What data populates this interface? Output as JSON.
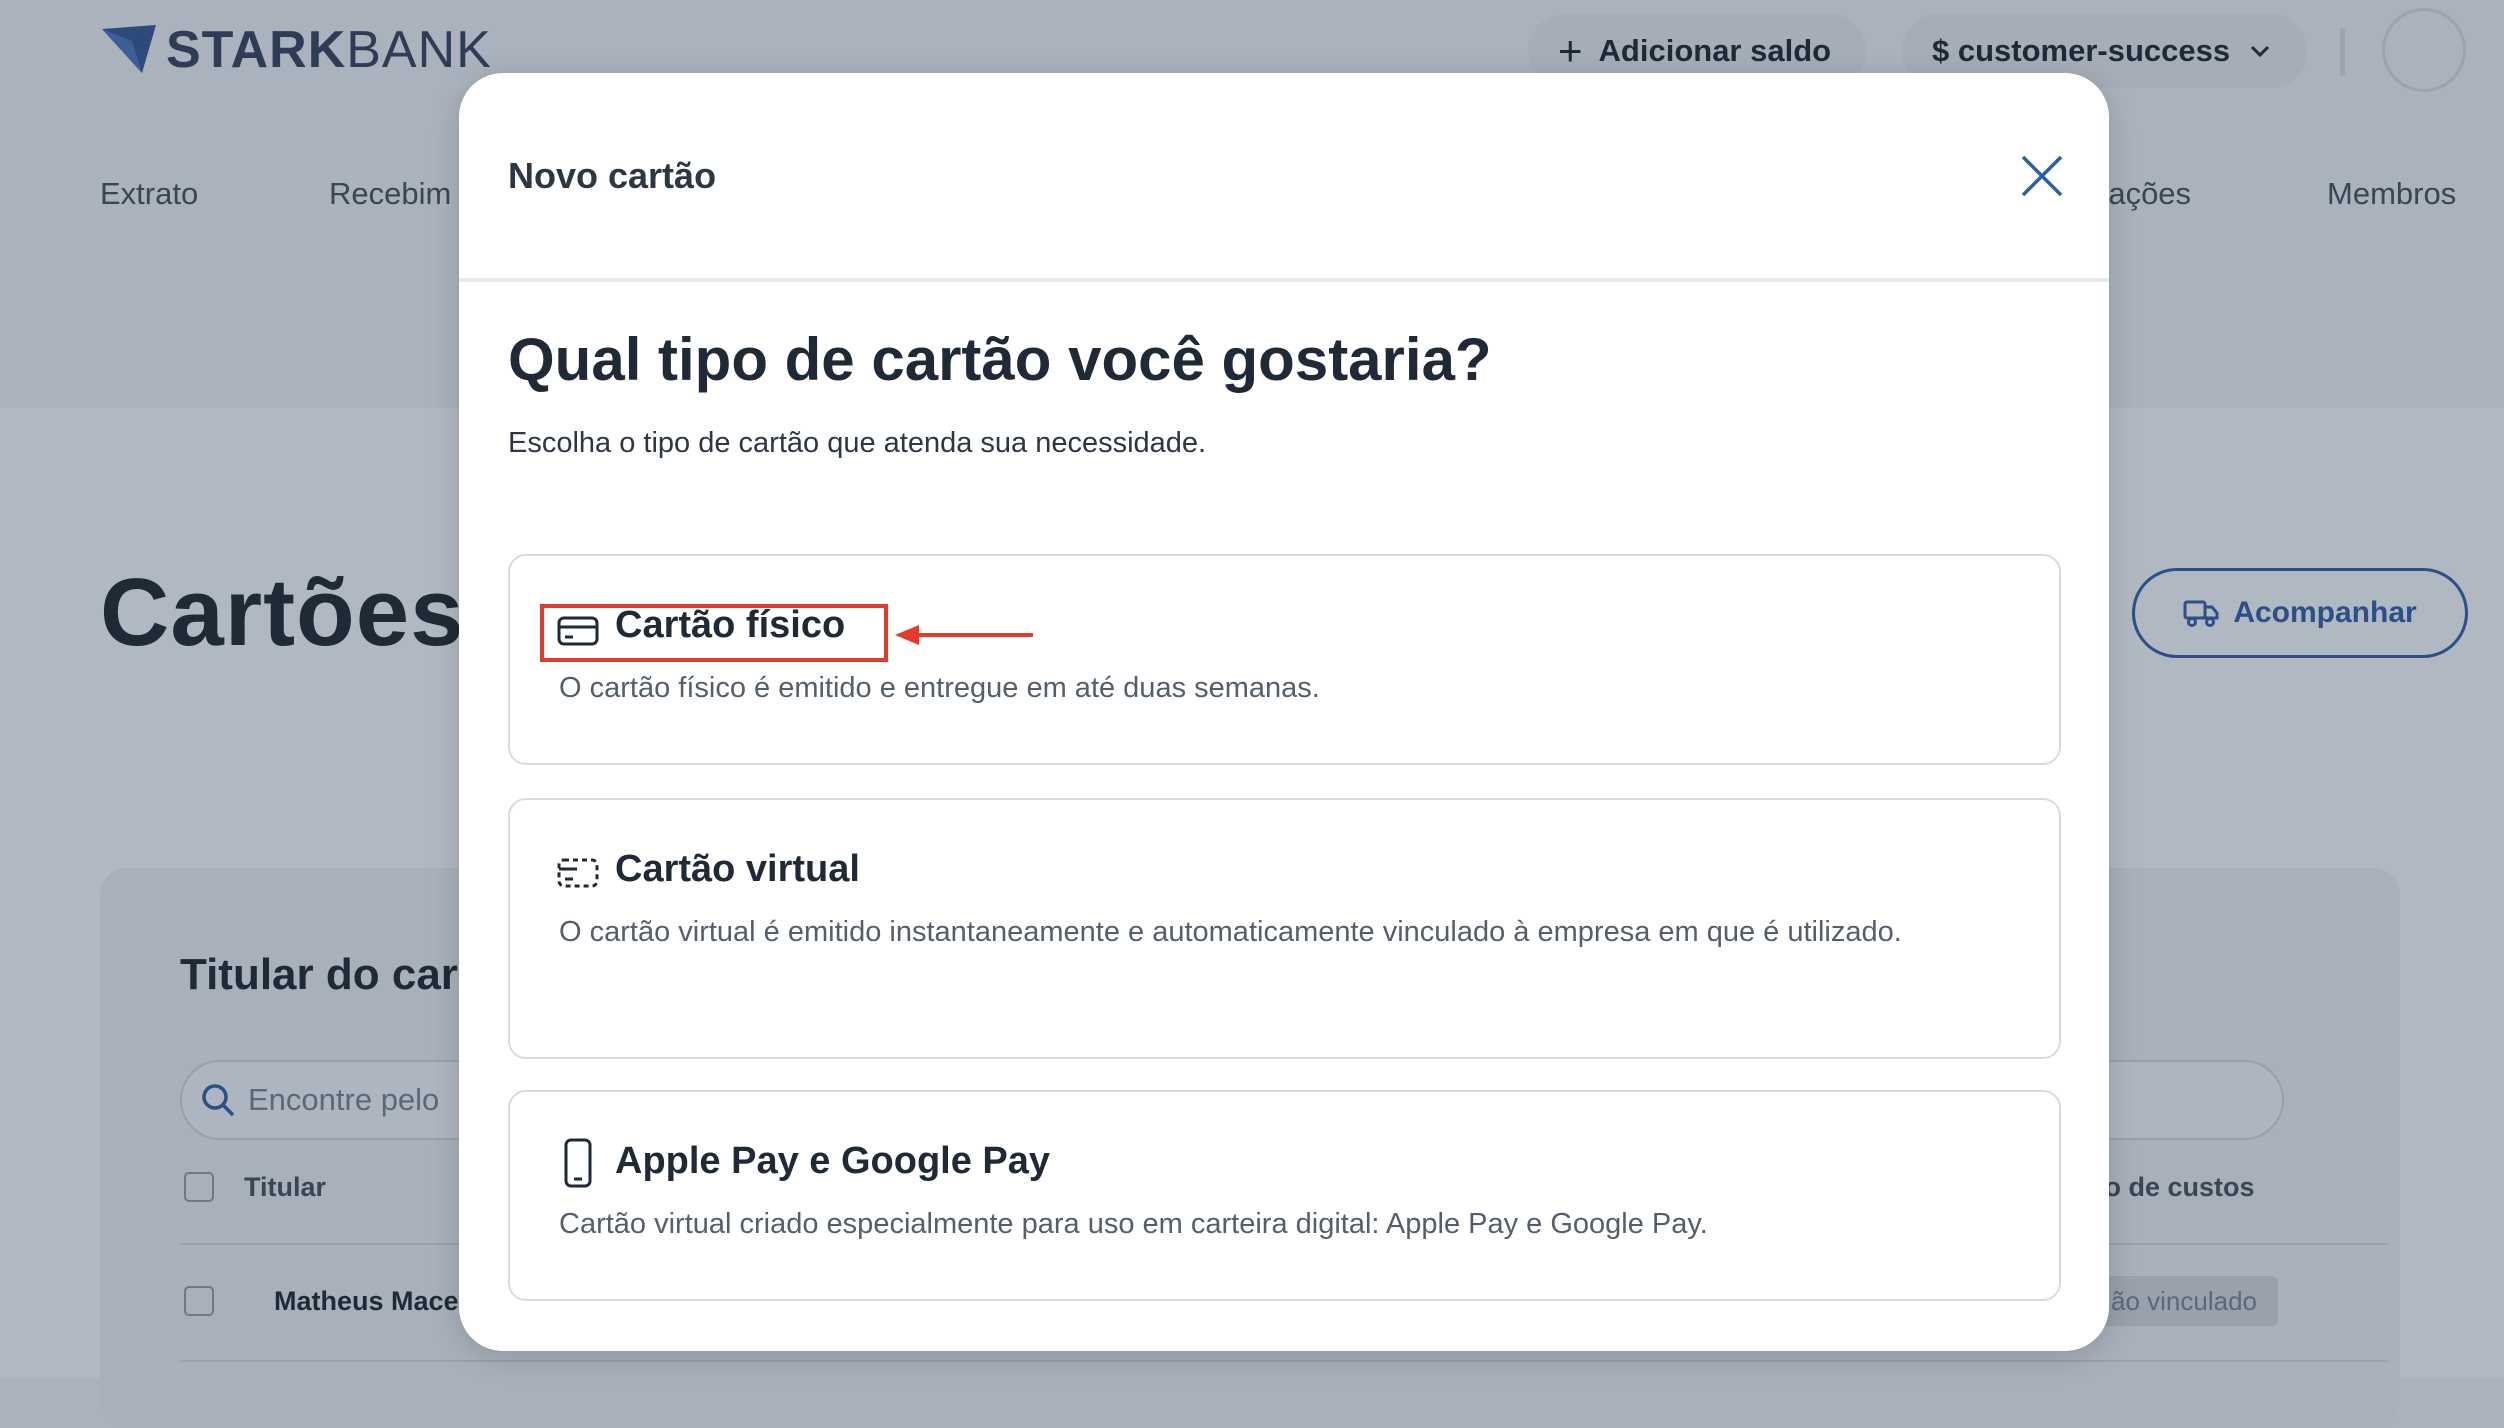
{
  "app": {
    "logo_bold": "STARK",
    "logo_light": "BANK",
    "add_balance": "Adicionar saldo",
    "account": "$ customer-success"
  },
  "nav": [
    "Extrato",
    "Recebim",
    "rações",
    "Membros"
  ],
  "page": {
    "title": "Cartões",
    "track_button": "Acompanhar",
    "section_title": "Titular do car",
    "search_placeholder": "Encontre pelo",
    "col_titular": "Titular",
    "col_centro": "ro de custos",
    "row_name": "Matheus Mace",
    "row_badge": "ão vinculado"
  },
  "modal": {
    "title": "Novo cartão",
    "heading": "Qual tipo de cartão você gostaria?",
    "subtitle": "Escolha o tipo de cartão que atenda sua necessidade.",
    "options": [
      {
        "title": "Cartão físico",
        "icon": "credit-card-icon",
        "description": "O cartão físico é emitido e entregue em até duas semanas."
      },
      {
        "title": "Cartão virtual",
        "icon": "virtual-card-icon",
        "description": "O cartão virtual é emitido instantaneamente e automaticamente vinculado à empresa em que é utilizado."
      },
      {
        "title": "Apple Pay e Google Pay",
        "icon": "smartphone-icon",
        "description": "Cartão virtual criado especialmente para uso em carteira digital: Apple Pay e Google Pay."
      }
    ]
  },
  "colors": {
    "accent": "#2b4f86",
    "annotation": "#e53a2a",
    "overlay": "#a9b2bd"
  }
}
